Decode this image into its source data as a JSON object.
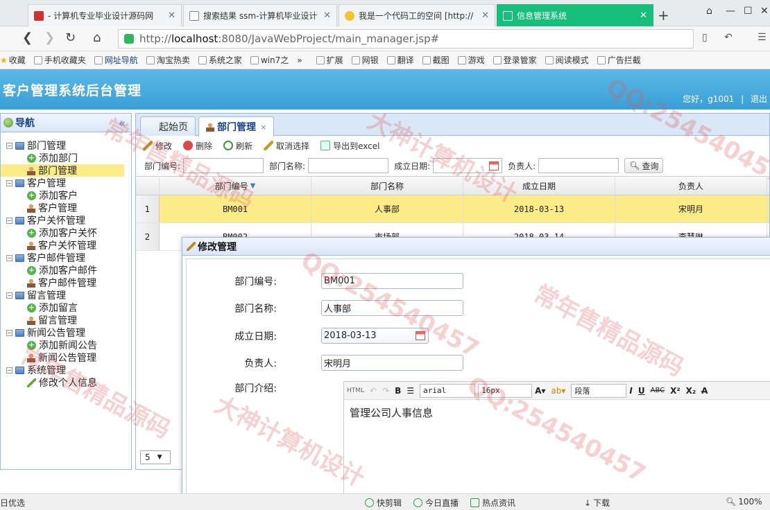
{
  "browser": {
    "tabs": [
      {
        "title": "- 计算机专业毕业设计源码网"
      },
      {
        "title": "搜索结果 ssm-计算机毕业设计"
      },
      {
        "title": "我是一个代码工的空间 [http://"
      },
      {
        "title": "信息管理系统"
      }
    ],
    "url_host": "localhost",
    "url_rest": ":8080/JavaWebProject/main_manager.jsp#",
    "url_scheme": "http://",
    "bookmarks": [
      "收藏",
      "手机收藏夹",
      "网址导航",
      "淘宝热卖",
      "系统之家",
      "win7之",
      "扩展",
      "网银",
      "翻译",
      "截图",
      "游戏",
      "登录管家",
      "阅读模式",
      "广告拦截"
    ],
    "status": {
      "left": "日优选",
      "items": [
        "快剪辑",
        "今日直播",
        "热点资讯",
        "下载"
      ],
      "zoom": "100%"
    }
  },
  "app": {
    "title": "客户管理系统后台管理",
    "greeting": "您好，g1001",
    "logout": "退出"
  },
  "nav": {
    "title": "导航",
    "groups": [
      {
        "label": "部门管理",
        "items": [
          "添加部门",
          "部门管理"
        ]
      },
      {
        "label": "客户管理",
        "items": [
          "添加客户",
          "客户管理"
        ]
      },
      {
        "label": "客户关怀管理",
        "items": [
          "添加客户关怀",
          "客户关怀管理"
        ]
      },
      {
        "label": "客户邮件管理",
        "items": [
          "添加客户邮件",
          "客户邮件管理"
        ]
      },
      {
        "label": "留言管理",
        "items": [
          "添加留言",
          "留言管理"
        ]
      },
      {
        "label": "新闻公告管理",
        "items": [
          "添加新闻公告",
          "新闻公告管理"
        ]
      },
      {
        "label": "系统管理",
        "items": [
          "修改个人信息"
        ]
      }
    ]
  },
  "main": {
    "tabs": [
      {
        "label": "起始页"
      },
      {
        "label": "部门管理"
      }
    ],
    "toolbar": [
      "修改",
      "删除",
      "刷新",
      "取消选择",
      "导出到excel"
    ],
    "search": {
      "dept_code_label": "部门编号:",
      "dept_name_label": "部门名称:",
      "date_label": "成立日期:",
      "leader_label": "负责人:",
      "query_btn": "查询"
    },
    "grid": {
      "columns": [
        "部门编号",
        "部门名称",
        "成立日期",
        "负责人"
      ],
      "rows": [
        {
          "num": "1",
          "code": "BM001",
          "name": "人事部",
          "date": "2018-03-13",
          "leader": "宋明月"
        },
        {
          "num": "2",
          "code": "BM002",
          "name": "市场部",
          "date": "2018-03-14",
          "leader": "李慧琳"
        }
      ],
      "page_size": "5"
    }
  },
  "dialog": {
    "title": "修改管理",
    "fields": {
      "code_label": "部门编号:",
      "code_value": "BM001",
      "name_label": "部门名称:",
      "name_value": "人事部",
      "date_label": "成立日期:",
      "date_value": "2018-03-13",
      "leader_label": "负责人:",
      "leader_value": "宋明月",
      "intro_label": "部门介绍:"
    },
    "editor": {
      "font": "arial",
      "size": "16px",
      "para": "段落",
      "content": "管理公司人事信息"
    }
  },
  "watermarks": [
    "常年售精品源码",
    "大神计算机设计",
    "QQ:254540457"
  ]
}
